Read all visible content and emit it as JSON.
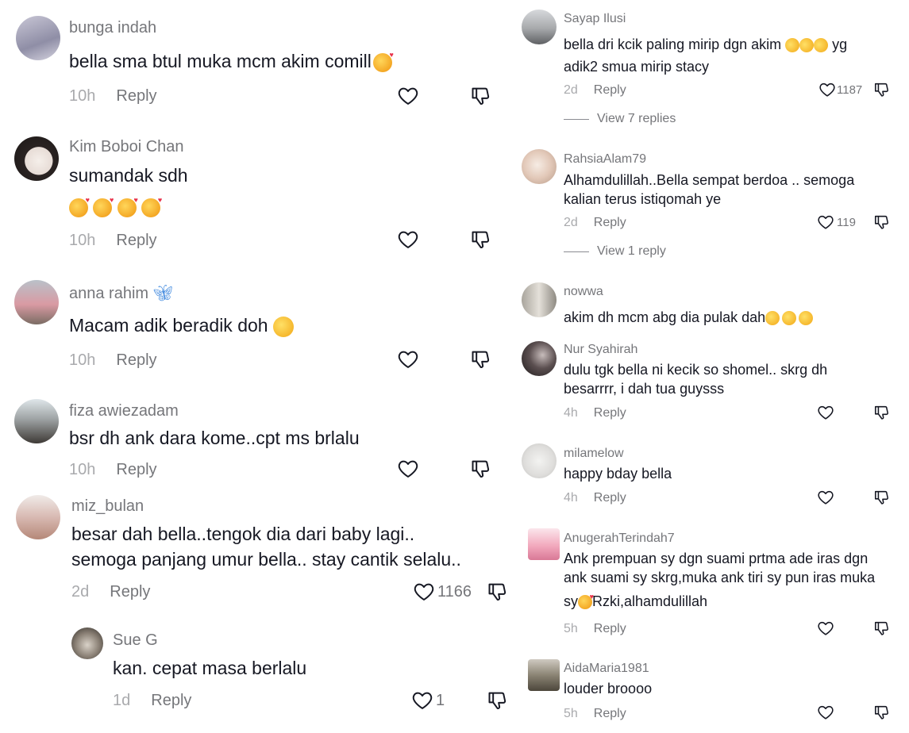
{
  "left_comments": [
    {
      "user": "bunga indah",
      "text": "bella sma btul muka mcm akim comill",
      "time": "10h",
      "reply": "Reply",
      "likes": ""
    },
    {
      "user": "Kim Boboi Chan",
      "text": "sumandak sdh",
      "time": "10h",
      "reply": "Reply",
      "likes": ""
    },
    {
      "user": "anna rahim",
      "text": "Macam adik beradik doh",
      "time": "10h",
      "reply": "Reply",
      "likes": ""
    },
    {
      "user": "fiza awiezadam",
      "text": "bsr dh ank dara kome..cpt ms brlalu",
      "time": "10h",
      "reply": "Reply",
      "likes": ""
    },
    {
      "user": "miz_bulan",
      "text_line1": "besar dah bella..tengok dia dari baby lagi..",
      "text_line2": "semoga panjang umur bella.. stay cantik selalu..",
      "time": "2d",
      "reply": "Reply",
      "likes": "1166"
    },
    {
      "user": "Sue G",
      "text": "kan. cepat masa berlalu",
      "time": "1d",
      "reply": "Reply",
      "likes": "1"
    }
  ],
  "right_comments": [
    {
      "user": "Sayap Ilusi",
      "text_line1": "bella dri kcik paling mirip dgn akim",
      "text_line1_tail": "yg",
      "text_line2": "adik2 smua mirip stacy",
      "time": "2d",
      "reply": "Reply",
      "likes": "1187",
      "view_replies": "View 7 replies"
    },
    {
      "user": "RahsiaAlam79",
      "text_line1": "Alhamdulillah..Bella sempat berdoa .. semoga",
      "text_line2": "kalian terus istiqomah ye",
      "time": "2d",
      "reply": "Reply",
      "likes": "119",
      "view_replies": "View 1 reply"
    },
    {
      "user": "nowwa",
      "text": "akim dh mcm abg dia pulak dah"
    },
    {
      "user": "Nur Syahirah",
      "text_line1": "dulu tgk bella ni kecik so shomel.. skrg dh",
      "text_line2": "besarrrr, i dah tua guysss",
      "time": "4h",
      "reply": "Reply"
    },
    {
      "user": "milamelow",
      "text": "happy bday bella",
      "time": "4h",
      "reply": "Reply"
    },
    {
      "user": "AnugerahTerindah7",
      "text_line1": "Ank prempuan sy dgn suami prtma ade iras dgn",
      "text_line2": "ank suami sy skrg,muka ank tiri sy pun iras muka",
      "text_line3_head": "sy",
      "text_line3_tail": "Rzki,alhamdulillah",
      "time": "5h",
      "reply": "Reply"
    },
    {
      "user": "AidaMaria1981",
      "text": "louder broooo",
      "time": "5h",
      "reply": "Reply"
    }
  ],
  "icons": {
    "like": "heart-outline-icon",
    "dislike": "thumbs-down-icon",
    "emoji_love": "smiling-face-with-hearts-emoji",
    "emoji_lol": "face-with-tears-of-joy-emoji",
    "emoji_rofl": "rolling-on-floor-laughing-emoji",
    "butterfly": "butterfly-emoji"
  },
  "colors": {
    "username": "#75767a",
    "text": "#161823",
    "time": "#a9aaad"
  }
}
